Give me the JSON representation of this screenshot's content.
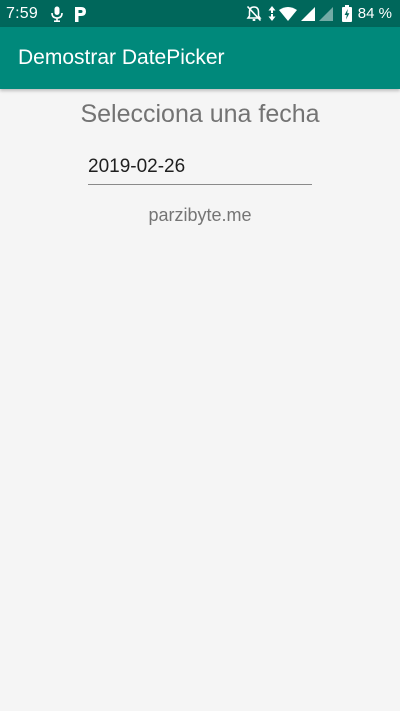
{
  "status_bar": {
    "time": "7:59",
    "battery_percent": "84 %",
    "icons": [
      "microphone-icon",
      "parking-app-icon",
      "notifications-off-icon",
      "data-arrows-icon",
      "wifi-icon",
      "signal-icon",
      "signal-weak-icon",
      "battery-charging-icon"
    ]
  },
  "app_bar": {
    "title": "Demostrar DatePicker"
  },
  "main": {
    "heading": "Selecciona una fecha",
    "date_value": "2019-02-26",
    "footer_text": "parzibyte.me"
  },
  "colors": {
    "status_bar": "#00675b",
    "app_bar": "#00897b",
    "background": "#f5f5f5",
    "heading_text": "#737373"
  }
}
